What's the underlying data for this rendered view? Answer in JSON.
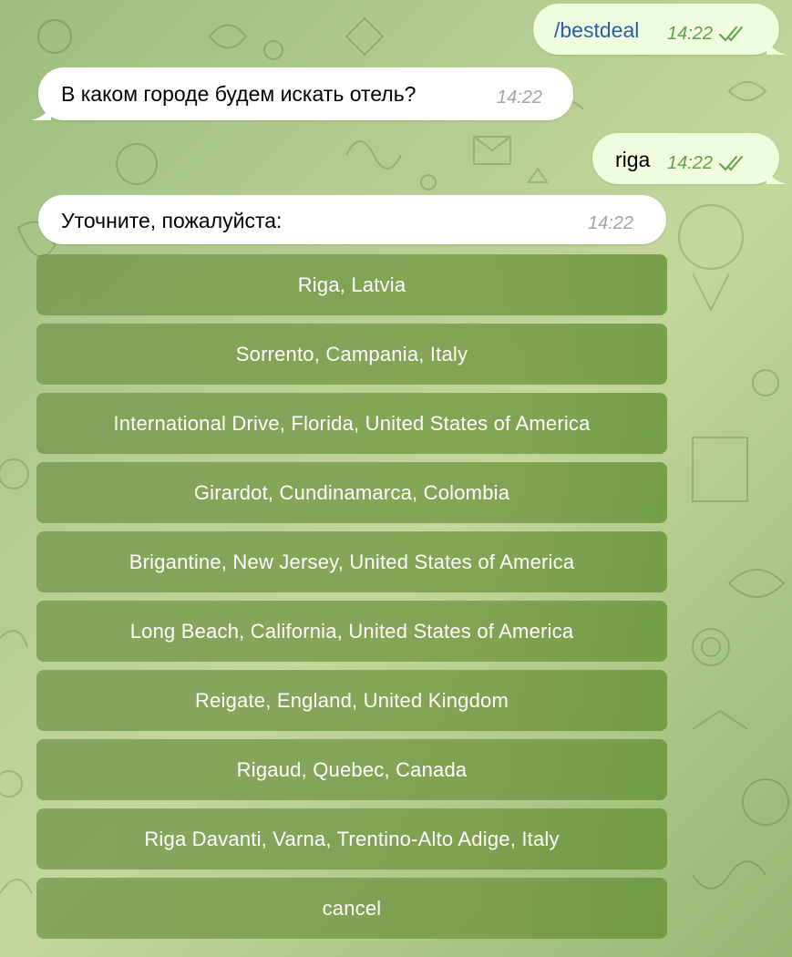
{
  "messages": [
    {
      "id": "m1",
      "direction": "out",
      "text": "/bestdeal",
      "time": "14:22",
      "status": "read"
    },
    {
      "id": "m2",
      "direction": "in",
      "text": "В каком городе будем искать отель?",
      "time": "14:22"
    },
    {
      "id": "m3",
      "direction": "out",
      "text": "riga",
      "time": "14:22",
      "status": "read"
    },
    {
      "id": "m4",
      "direction": "in",
      "text": "Уточните, пожалуйста:",
      "time": "14:22"
    }
  ],
  "keyboard": {
    "buttons": [
      {
        "label": "Riga, Latvia"
      },
      {
        "label": "Sorrento, Campania, Italy"
      },
      {
        "label": "International Drive, Florida, United States of America"
      },
      {
        "label": "Girardot, Cundinamarca, Colombia"
      },
      {
        "label": "Brigantine, New Jersey, United States of America"
      },
      {
        "label": "Long Beach, California, United States of America"
      },
      {
        "label": "Reigate, England, United Kingdom"
      },
      {
        "label": "Rigaud, Quebec, Canada"
      },
      {
        "label": "Riga Davanti, Varna, Trentino-Alto Adige, Italy"
      },
      {
        "label": "cancel"
      }
    ]
  },
  "colors": {
    "outgoing_bubble": "#effdde",
    "incoming_bubble": "#ffffff",
    "command_text": "#2b5cab",
    "outgoing_meta": "#5ea14b",
    "incoming_meta": "#a3a3a3"
  }
}
